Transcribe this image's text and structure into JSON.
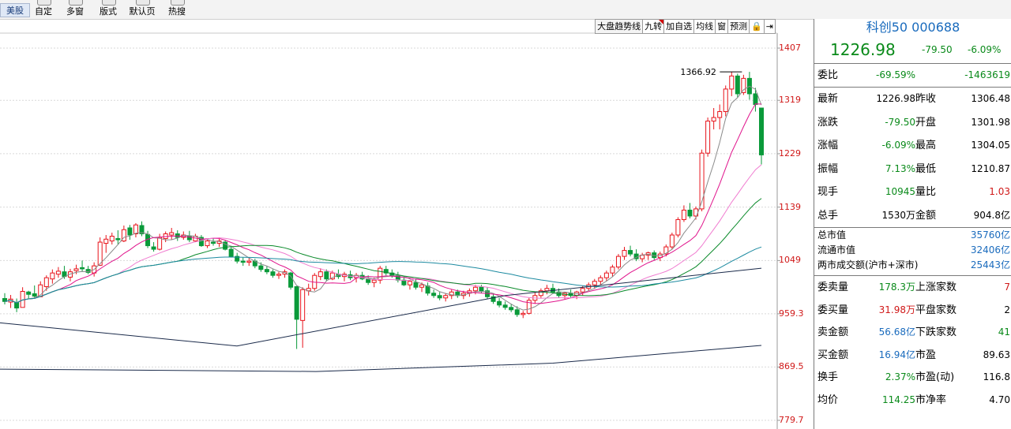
{
  "toolbar": {
    "market_tab": "美股",
    "buttons": [
      "自定",
      "多窗",
      "版式",
      "默认页",
      "热搜"
    ]
  },
  "chart_toolbar": {
    "buttons": [
      "大盘趋势线",
      "九转",
      "加自选",
      "均线",
      "窗",
      "预测",
      "🔒",
      "⇥"
    ]
  },
  "chart_data": {
    "type": "candlestick",
    "y_ticks": [
      "1407",
      "1319",
      "1229",
      "1139",
      "1049",
      "959.3",
      "869.5",
      "779.7"
    ],
    "ylim": [
      779.7,
      1407
    ],
    "annotation": "1366.92",
    "colors": {
      "up": "#e8141b",
      "down": "#0a9a3a",
      "ma5": "#8a8a8a",
      "ma10": "#e0148c",
      "ma20": "#f07cd0",
      "ma60": "#0a8a2a",
      "ma120": "#1c8aa0",
      "ma250": "#1a2a4a"
    },
    "candles": [
      [
        985,
        994,
        975,
        980
      ],
      [
        979,
        991,
        969,
        984
      ],
      [
        978,
        985,
        962,
        969
      ],
      [
        970,
        1004,
        971,
        997
      ],
      [
        996,
        998,
        985,
        992
      ],
      [
        993,
        1007,
        987,
        989
      ],
      [
        988,
        1014,
        990,
        1008
      ],
      [
        1005,
        1024,
        998,
        1020
      ],
      [
        1018,
        1034,
        1010,
        1028
      ],
      [
        1026,
        1038,
        1020,
        1031
      ],
      [
        1030,
        1040,
        1018,
        1022
      ],
      [
        1021,
        1035,
        1014,
        1030
      ],
      [
        1032,
        1042,
        1026,
        1035
      ],
      [
        1037,
        1049,
        1030,
        1035
      ],
      [
        1034,
        1040,
        1026,
        1029
      ],
      [
        1028,
        1046,
        1022,
        1040
      ],
      [
        1041,
        1088,
        1040,
        1080
      ],
      [
        1078,
        1092,
        1062,
        1085
      ],
      [
        1082,
        1096,
        1076,
        1090
      ],
      [
        1086,
        1100,
        1076,
        1084
      ],
      [
        1082,
        1108,
        1080,
        1101
      ],
      [
        1104,
        1109,
        1084,
        1092
      ],
      [
        1094,
        1112,
        1088,
        1109
      ],
      [
        1108,
        1115,
        1090,
        1094
      ],
      [
        1093,
        1099,
        1070,
        1074
      ],
      [
        1072,
        1080,
        1064,
        1068
      ],
      [
        1068,
        1094,
        1066,
        1088
      ],
      [
        1086,
        1098,
        1080,
        1094
      ],
      [
        1092,
        1104,
        1084,
        1096
      ],
      [
        1094,
        1100,
        1082,
        1088
      ],
      [
        1088,
        1098,
        1084,
        1092
      ],
      [
        1090,
        1099,
        1080,
        1084
      ],
      [
        1082,
        1094,
        1080,
        1090
      ],
      [
        1088,
        1092,
        1072,
        1074
      ],
      [
        1074,
        1086,
        1070,
        1082
      ],
      [
        1080,
        1086,
        1074,
        1078
      ],
      [
        1078,
        1088,
        1072,
        1082
      ],
      [
        1080,
        1084,
        1066,
        1068
      ],
      [
        1068,
        1074,
        1054,
        1056
      ],
      [
        1056,
        1062,
        1044,
        1048
      ],
      [
        1048,
        1054,
        1040,
        1046
      ],
      [
        1046,
        1054,
        1040,
        1048
      ],
      [
        1048,
        1052,
        1036,
        1040
      ],
      [
        1040,
        1046,
        1030,
        1034
      ],
      [
        1034,
        1040,
        1026,
        1030
      ],
      [
        1030,
        1034,
        1020,
        1024
      ],
      [
        1024,
        1030,
        1018,
        1026
      ],
      [
        1026,
        1034,
        1020,
        1030
      ],
      [
        1028,
        1030,
        1000,
        1004
      ],
      [
        1005,
        1006,
        900,
        950
      ],
      [
        948,
        1004,
        902,
        1000
      ],
      [
        998,
        1010,
        990,
        1002
      ],
      [
        1002,
        1028,
        998,
        1024
      ],
      [
        1022,
        1036,
        1016,
        1030
      ],
      [
        1030,
        1034,
        1014,
        1018
      ],
      [
        1018,
        1032,
        1016,
        1028
      ],
      [
        1026,
        1034,
        1018,
        1022
      ],
      [
        1022,
        1030,
        1014,
        1026
      ],
      [
        1025,
        1032,
        1016,
        1020
      ],
      [
        1020,
        1028,
        1012,
        1024
      ],
      [
        1024,
        1030,
        1016,
        1018
      ],
      [
        1018,
        1024,
        1008,
        1012
      ],
      [
        1012,
        1020,
        1004,
        1016
      ],
      [
        1016,
        1040,
        1010,
        1036
      ],
      [
        1034,
        1040,
        1024,
        1028
      ],
      [
        1028,
        1034,
        1020,
        1024
      ],
      [
        1024,
        1030,
        1012,
        1016
      ],
      [
        1016,
        1022,
        1006,
        1008
      ],
      [
        1008,
        1016,
        1000,
        1014
      ],
      [
        1012,
        1018,
        1000,
        1004
      ],
      [
        1004,
        1012,
        996,
        1008
      ],
      [
        1006,
        1012,
        990,
        994
      ],
      [
        994,
        1000,
        986,
        990
      ],
      [
        990,
        996,
        982,
        986
      ],
      [
        986,
        994,
        980,
        990
      ],
      [
        990,
        1000,
        984,
        996
      ],
      [
        996,
        1000,
        986,
        990
      ],
      [
        990,
        998,
        984,
        994
      ],
      [
        994,
        1002,
        988,
        998
      ],
      [
        998,
        1008,
        992,
        1004
      ],
      [
        1004,
        1008,
        994,
        998
      ],
      [
        998,
        1004,
        984,
        988
      ],
      [
        988,
        994,
        976,
        980
      ],
      [
        980,
        986,
        970,
        974
      ],
      [
        974,
        980,
        966,
        970
      ],
      [
        970,
        976,
        962,
        966
      ],
      [
        966,
        972,
        954,
        958
      ],
      [
        958,
        964,
        952,
        960
      ],
      [
        960,
        986,
        958,
        982
      ],
      [
        982,
        996,
        976,
        990
      ],
      [
        990,
        1002,
        986,
        998
      ],
      [
        998,
        1008,
        992,
        1002
      ],
      [
        1002,
        1010,
        994,
        996
      ],
      [
        996,
        1002,
        986,
        990
      ],
      [
        990,
        996,
        984,
        994
      ],
      [
        994,
        1000,
        986,
        990
      ],
      [
        990,
        998,
        984,
        996
      ],
      [
        996,
        1006,
        990,
        1002
      ],
      [
        1002,
        1012,
        998,
        1008
      ],
      [
        1008,
        1018,
        1002,
        1014
      ],
      [
        1014,
        1024,
        1008,
        1020
      ],
      [
        1020,
        1032,
        1014,
        1028
      ],
      [
        1028,
        1042,
        1022,
        1038
      ],
      [
        1038,
        1060,
        1034,
        1056
      ],
      [
        1056,
        1072,
        1050,
        1066
      ],
      [
        1066,
        1074,
        1056,
        1060
      ],
      [
        1060,
        1068,
        1048,
        1052
      ],
      [
        1052,
        1062,
        1046,
        1058
      ],
      [
        1058,
        1064,
        1050,
        1062
      ],
      [
        1062,
        1066,
        1050,
        1054
      ],
      [
        1054,
        1064,
        1048,
        1060
      ],
      [
        1060,
        1076,
        1056,
        1072
      ],
      [
        1072,
        1096,
        1068,
        1092
      ],
      [
        1092,
        1122,
        1088,
        1118
      ],
      [
        1118,
        1142,
        1114,
        1134
      ],
      [
        1134,
        1146,
        1120,
        1124
      ],
      [
        1124,
        1140,
        1118,
        1136
      ],
      [
        1136,
        1236,
        1132,
        1230
      ],
      [
        1230,
        1290,
        1224,
        1284
      ],
      [
        1284,
        1306,
        1270,
        1290
      ],
      [
        1290,
        1312,
        1270,
        1300
      ],
      [
        1300,
        1344,
        1292,
        1338
      ],
      [
        1338,
        1367,
        1326,
        1360
      ],
      [
        1360,
        1364,
        1324,
        1330
      ],
      [
        1332,
        1362,
        1328,
        1356
      ],
      [
        1356,
        1367,
        1320,
        1330
      ],
      [
        1330,
        1340,
        1300,
        1312
      ],
      [
        1306,
        1306,
        1211,
        1227
      ]
    ]
  },
  "panel": {
    "title": "科创50 000688",
    "price": "1226.98",
    "change": "-79.50",
    "pct": "-6.09%",
    "weibi_label": "委比",
    "weibi_pct": "-69.59%",
    "weibi_val": "-1463619",
    "quote_rows": [
      {
        "k1": "最新",
        "v1": "1226.98",
        "v1c": "k",
        "k2": "昨收",
        "v2": "1306.48",
        "v2c": "k"
      },
      {
        "k1": "涨跌",
        "v1": "-79.50",
        "v1c": "g",
        "k2": "开盘",
        "v2": "1301.98",
        "v2c": "k"
      },
      {
        "k1": "涨幅",
        "v1": "-6.09%",
        "v1c": "g",
        "k2": "最高",
        "v2": "1304.05",
        "v2c": "k"
      },
      {
        "k1": "振幅",
        "v1": "7.13%",
        "v1c": "g",
        "k2": "最低",
        "v2": "1210.87",
        "v2c": "k"
      },
      {
        "k1": "现手",
        "v1": "10945",
        "v1c": "g",
        "k2": "量比",
        "v2": "1.03",
        "v2c": "r"
      },
      {
        "k1": "总手",
        "v1": "1530万",
        "v1c": "k",
        "k2": "金额",
        "v2": "904.8亿",
        "v2c": "k"
      }
    ],
    "market_rows": [
      {
        "k": "总市值",
        "v": "35760亿"
      },
      {
        "k": "流通市值",
        "v": "32406亿"
      },
      {
        "k": "两市成交额(沪市+深市)",
        "v": "25443亿"
      }
    ],
    "stat_rows": [
      {
        "k1": "委卖量",
        "v1": "178.3万",
        "v1c": "g",
        "k2": "上涨家数",
        "v2": "7",
        "v2c": "r"
      },
      {
        "k1": "委买量",
        "v1": "31.98万",
        "v1c": "r",
        "k2": "平盘家数",
        "v2": "2",
        "v2c": "k"
      },
      {
        "k1": "卖金额",
        "v1": "56.68亿",
        "v1c": "b",
        "k2": "下跌家数",
        "v2": "41",
        "v2c": "g"
      },
      {
        "k1": "买金额",
        "v1": "16.94亿",
        "v1c": "b",
        "k2": "市盈",
        "v2": "89.63",
        "v2c": "k"
      },
      {
        "k1": "换手",
        "v1": "2.37%",
        "v1c": "g",
        "k2": "市盈(动)",
        "v2": "116.8",
        "v2c": "k"
      },
      {
        "k1": "均价",
        "v1": "114.25",
        "v1c": "g",
        "k2": "市净率",
        "v2": "4.70",
        "v2c": "k"
      }
    ]
  }
}
